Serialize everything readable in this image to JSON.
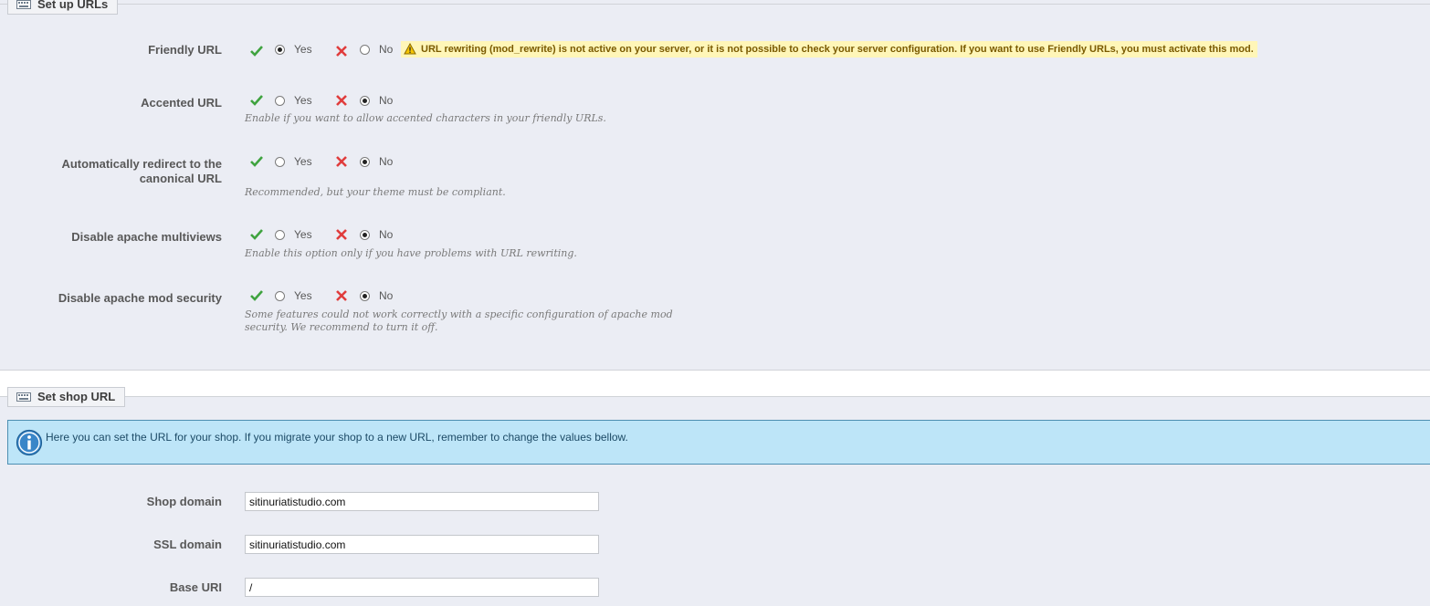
{
  "urls_section": {
    "legend": "Set up URLs",
    "rows": [
      {
        "label": "Friendly URL",
        "yes": "Yes",
        "no": "No",
        "selected": "yes",
        "warning": "URL rewriting (mod_rewrite) is not active on your server, or it is not possible to check your server configuration. If you want to use Friendly URLs, you must activate this mod."
      },
      {
        "label": "Accented URL",
        "yes": "Yes",
        "no": "No",
        "selected": "no",
        "help": "Enable if you want to allow accented characters in your friendly URLs."
      },
      {
        "label_line1": "Automatically redirect to the",
        "label_line2": "canonical URL",
        "yes": "Yes",
        "no": "No",
        "selected": "no",
        "help": "Recommended, but your theme must be compliant."
      },
      {
        "label": "Disable apache multiviews",
        "yes": "Yes",
        "no": "No",
        "selected": "no",
        "help": "Enable this option only if you have problems with URL rewriting."
      },
      {
        "label": "Disable apache mod security",
        "yes": "Yes",
        "no": "No",
        "selected": "no",
        "help_line1": "Some features could not work correctly with a specific configuration of apache mod",
        "help_line2": "security. We recommend to turn it off."
      }
    ]
  },
  "shop_section": {
    "legend": "Set shop URL",
    "info": "Here you can set the URL for your shop. If you migrate your shop to a new URL, remember to change the values bellow.",
    "fields": [
      {
        "label": "Shop domain",
        "value": "sitinuriatistudio.com"
      },
      {
        "label": "SSL domain",
        "value": "sitinuriatistudio.com"
      },
      {
        "label": "Base URI",
        "value": "/"
      }
    ]
  },
  "colors": {
    "background": "#ebedf4",
    "check": "#3fa33f",
    "cross": "#e03c3c",
    "warning_bg": "#fff6b8",
    "info_bg": "#bde5f8",
    "info_border": "#4d8fb2"
  }
}
